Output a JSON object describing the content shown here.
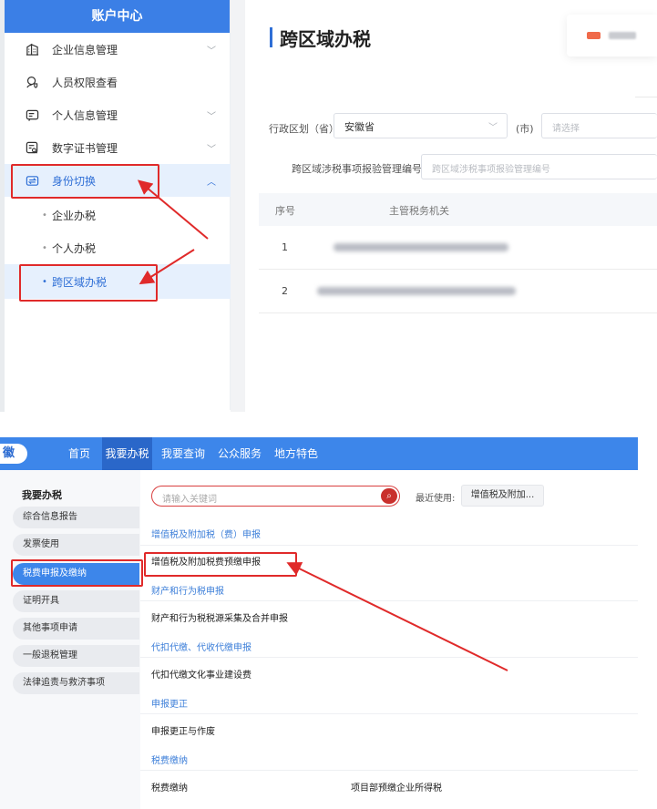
{
  "top": {
    "sidebar": {
      "header": "账户中心",
      "items": [
        {
          "label": "企业信息管理",
          "icon": "building-icon",
          "has_chevron": true
        },
        {
          "label": "人员权限查看",
          "icon": "user-shield-icon",
          "has_chevron": false
        },
        {
          "label": "个人信息管理",
          "icon": "id-card-icon",
          "has_chevron": true
        },
        {
          "label": "数字证书管理",
          "icon": "certificate-search-icon",
          "has_chevron": true
        },
        {
          "label": "身份切换",
          "icon": "switch-identity-icon",
          "has_chevron": true,
          "active": true
        }
      ],
      "sub_items": [
        {
          "label": "企业办税"
        },
        {
          "label": "个人办税"
        },
        {
          "label": "跨区域办税",
          "active": true
        }
      ],
      "chevron_down": "﹀",
      "chevron_up": "︿",
      "bullet": "•"
    },
    "page": {
      "title": "跨区域办税",
      "form": {
        "province_label": "行政区划（省）",
        "province_value": "安徽省",
        "city_label": "(市)",
        "city_placeholder": "请选择",
        "code_label": "跨区域涉税事项报验管理编号",
        "code_placeholder": "跨区域涉税事项报验管理编号"
      },
      "table": {
        "headers": [
          "序号",
          "主管税务机关"
        ],
        "rows": [
          {
            "index": "1"
          },
          {
            "index": "2"
          }
        ]
      }
    }
  },
  "bottom": {
    "brand": "徽",
    "nav": [
      {
        "label": "首页",
        "active": false
      },
      {
        "label": "我要办税",
        "active": true
      },
      {
        "label": "我要查询",
        "active": false
      },
      {
        "label": "公众服务",
        "active": false
      },
      {
        "label": "地方特色",
        "active": false
      }
    ],
    "left_menu": {
      "title": "我要办税",
      "items": [
        {
          "label": "综合信息报告"
        },
        {
          "label": "发票使用"
        },
        {
          "label": "税费申报及缴纳",
          "active": true
        },
        {
          "label": "证明开具"
        },
        {
          "label": "其他事项申请"
        },
        {
          "label": "一般退税管理"
        },
        {
          "label": "法律追责与救济事项"
        }
      ]
    },
    "search": {
      "placeholder": "请输入关键词",
      "button_icon": "search-icon",
      "recent_label": "最近使用:",
      "recent_chip": "增值税及附加..."
    },
    "sections": [
      {
        "title": "增值税及附加税（费）申报",
        "links": [
          "增值税及附加税费预缴申报"
        ]
      },
      {
        "title": "财产和行为税申报",
        "links": [
          "财产和行为税税源采集及合并申报"
        ]
      },
      {
        "title": "代扣代缴、代收代缴申报",
        "links": [
          "代扣代缴文化事业建设费"
        ]
      },
      {
        "title": "申报更正",
        "links": [
          "申报更正与作废"
        ]
      },
      {
        "title": "税费缴纳",
        "links": [
          "税费缴纳",
          "项目部预缴企业所得税"
        ]
      }
    ],
    "search_glyph": "⌕"
  },
  "colors": {
    "brand_blue": "#3d86ea",
    "active_nav": "#2a67c9",
    "sidebar_header": "#3b7fe6",
    "annotation_red": "#e02a2a",
    "search_red": "#c9302c",
    "section_blue": "#3d7fd9"
  }
}
